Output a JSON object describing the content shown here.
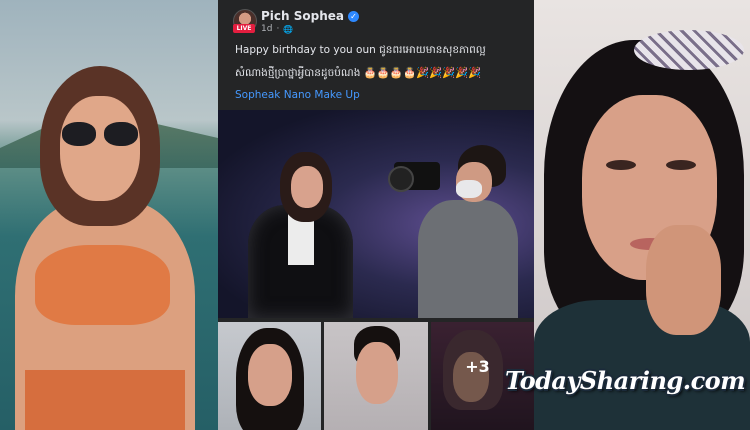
{
  "post": {
    "author": "Pich Sophea",
    "live_badge": "LIVE",
    "time": "1d",
    "separator": "·",
    "line1": "Happy birthday to you oun ជូនពរអោយមានសុខភាពល្អ",
    "line2": "សំណាងថ្មីប្រាថ្នាអ្វីបានដូចបំណង 🎂🎂🎂🎂🎉🎉🎉🎉🎉",
    "tagged_page": "Sopheak Nano Make Up",
    "more_photos": "+3"
  },
  "icons": {
    "verified": "verified-badge-icon",
    "audience": "globe-icon"
  },
  "watermark": "TodaySharing.com",
  "colors": {
    "post_background": "#242526",
    "link_blue": "#4599ff",
    "verified_blue": "#2d88ff",
    "live_red": "#e41e3f"
  }
}
